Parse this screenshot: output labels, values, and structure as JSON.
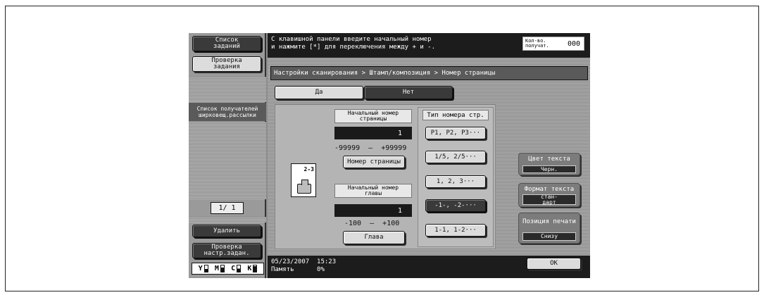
{
  "sidebar": {
    "job_list": "Список\nзаданий",
    "job_check": "Проверка\nзадания",
    "address_list": "Список получателей\nширковещ.рассылки",
    "page_indicator": "1/ 1",
    "delete": "Удалить",
    "check_settings": "Проверка\nнастр.задан.",
    "toner": [
      {
        "label": "Y",
        "level": 0.45
      },
      {
        "label": "M",
        "level": 0.65
      },
      {
        "label": "C",
        "level": 0.5
      },
      {
        "label": "K",
        "level": 0.9
      }
    ]
  },
  "header": {
    "message": "С клавишной панели введите начальный номер\nи нажмите [*] для переключения между + и -.",
    "recipients_label": "Кол-во.\nполучат.",
    "recipients_count": "000"
  },
  "breadcrumb": "Настройки сканирования > Штамп/композиция > Номер страницы",
  "toggle": {
    "yes": "Да",
    "no": "Нет",
    "selected": "Нет"
  },
  "preview": {
    "page_mark": "2-3"
  },
  "start_page": {
    "label": "Начальный номер\nстраницы",
    "value": "1",
    "range": "-99999  –  +99999",
    "button": "Номер страницы"
  },
  "start_chapter": {
    "label": "Начальный номер\nглавы",
    "value": "1",
    "range": "-100  –  +100",
    "button": "Глава"
  },
  "page_type": {
    "title": "Тип номера стр.",
    "options": [
      "P1, P2, P3···",
      "1/5, 2/5···",
      "1, 2, 3···",
      "-1-, -2-···",
      "1-1, 1-2···"
    ],
    "selected_index": 3
  },
  "text_color": {
    "label": "Цвет текста",
    "value": "Черн."
  },
  "text_format": {
    "label": "Формат текста",
    "value": "стан-\nдарт"
  },
  "print_position": {
    "label": "Позиция печати",
    "value": "Снизу"
  },
  "footer": {
    "date": "05/23/2007",
    "time": "15:23",
    "memory_label": "Память",
    "memory_value": "0%",
    "ok": "OK"
  }
}
